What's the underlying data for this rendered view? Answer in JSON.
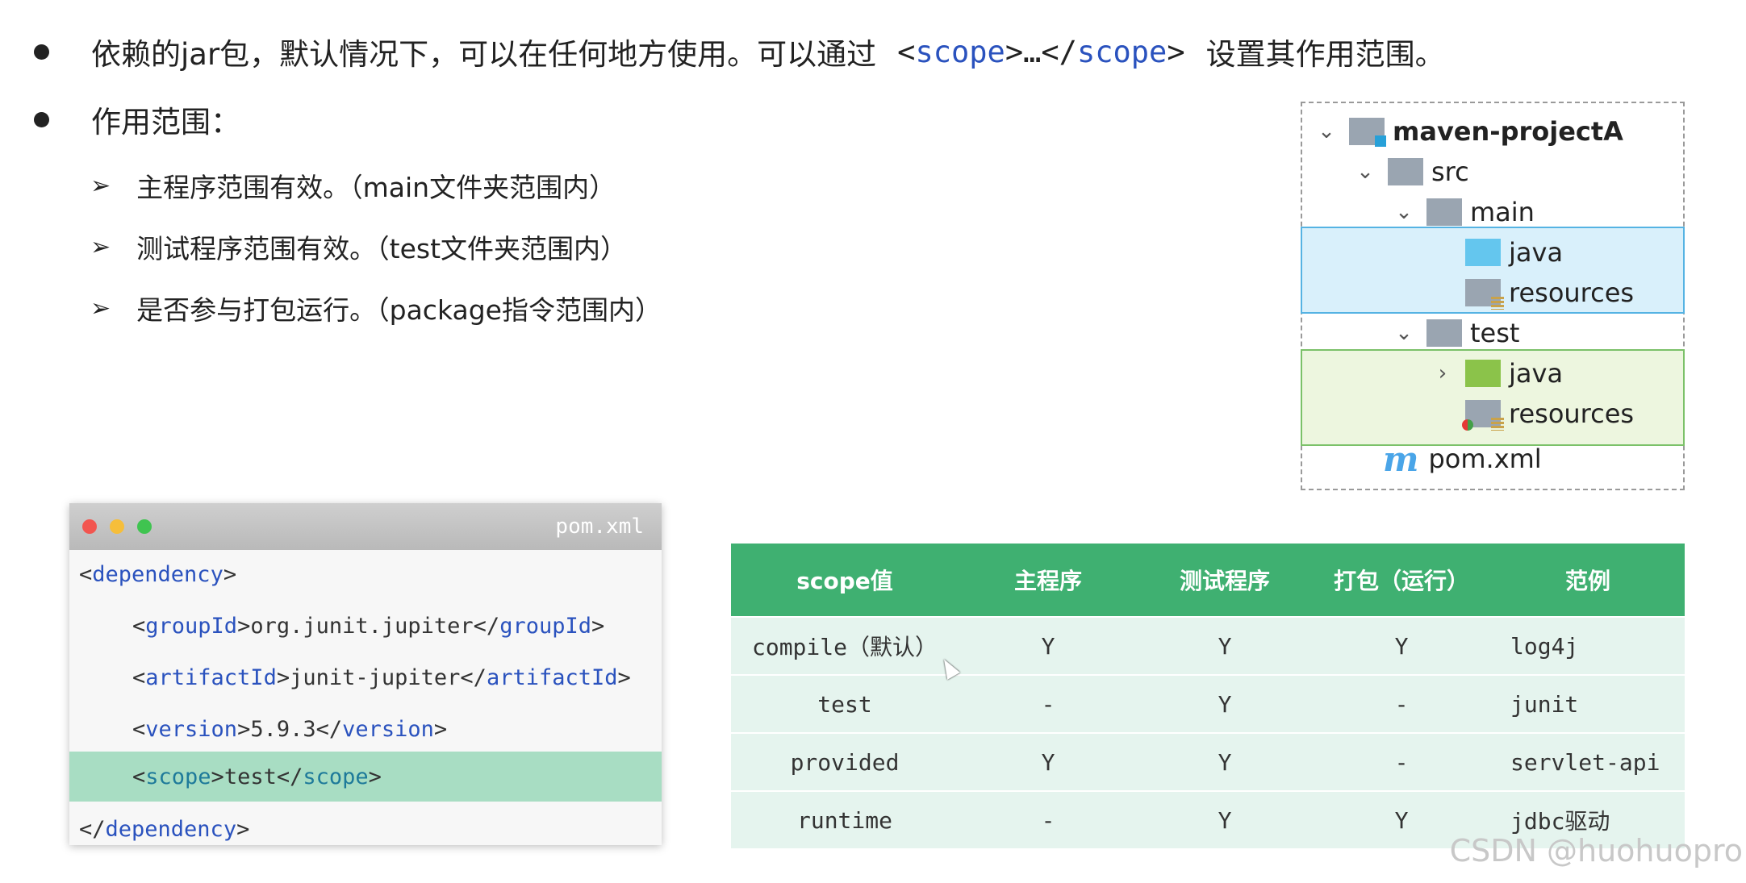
{
  "bullets": {
    "line1": {
      "text_before": "依赖的jar包，默认情况下，可以在任何地方使用。可以通过",
      "open_lt": "<",
      "open_tag": "scope",
      "mid": ">…</",
      "close_tag": "scope",
      "close_gt": ">",
      "text_after": "设置其作用范围。"
    },
    "line2": "作用范围："
  },
  "sub_items": [
    "主程序范围有效。（main文件夹范围内）",
    "测试程序范围有效。（test文件夹范围内）",
    "是否参与打包运行。（package指令范围内）"
  ],
  "tree": {
    "project": "maven-projectA",
    "src": "src",
    "main": "main",
    "main_java": "java",
    "main_resources": "resources",
    "test": "test",
    "test_java": "java",
    "test_resources": "resources",
    "pom_icon": "m",
    "pom": "pom.xml"
  },
  "code": {
    "filename": "pom.xml",
    "lines": [
      {
        "tag": "dependency",
        "text": ""
      },
      {
        "tag": "groupId",
        "text": "org.junit.jupiter"
      },
      {
        "tag": "artifactId",
        "text": "junit-jupiter"
      },
      {
        "tag": "version",
        "text": "5.9.3"
      },
      {
        "tag": "scope",
        "text": "test"
      },
      {
        "tag": "dependency",
        "text": ""
      }
    ]
  },
  "table": {
    "headers": [
      "scope值",
      "主程序",
      "测试程序",
      "打包（运行）",
      "范例"
    ],
    "rows": [
      [
        "compile（默认）",
        "Y",
        "Y",
        "Y",
        "log4j"
      ],
      [
        "test",
        "-",
        "Y",
        "-",
        "junit"
      ],
      [
        "provided",
        "Y",
        "Y",
        "-",
        "servlet-api"
      ],
      [
        "runtime",
        "-",
        "Y",
        "Y",
        "jdbc驱动"
      ]
    ]
  },
  "watermark": "CSDN @huohuopro",
  "colors": {
    "table_header": "#3fb071",
    "table_row": "#e5f4ee",
    "code_highlight": "#a8ddc3",
    "tag_blue": "#2a52be"
  }
}
